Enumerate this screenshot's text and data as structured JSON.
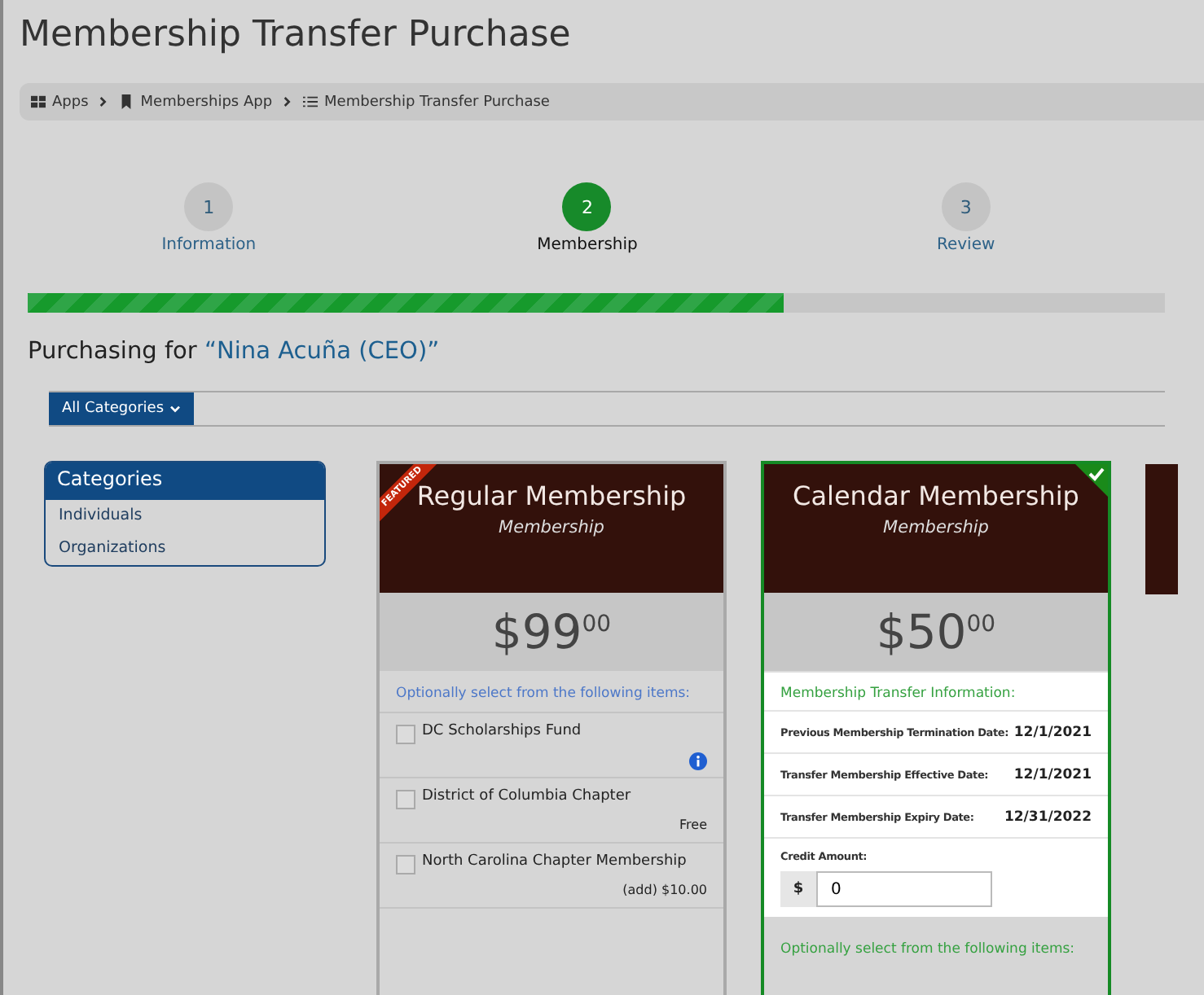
{
  "title": "Membership Transfer Purchase",
  "breadcrumbs": [
    {
      "label": "Apps"
    },
    {
      "label": "Memberships App"
    },
    {
      "label": "Membership Transfer Purchase"
    }
  ],
  "steps": [
    {
      "number": "1",
      "label": "Information",
      "selected": false
    },
    {
      "number": "2",
      "label": "Membership",
      "selected": true
    },
    {
      "number": "3",
      "label": "Review",
      "selected": false
    }
  ],
  "progress": {
    "level": 0.665
  },
  "purchasing": {
    "prefix": "Purchasing for ",
    "name": "“Nina Acuña (CEO)”"
  },
  "filter_button": "All Categories",
  "categories": {
    "title": "Categories",
    "items": [
      "Individuals",
      "Organizations"
    ]
  },
  "cards": [
    {
      "title": "Regular Membership",
      "subtitle": "Membership",
      "badge": "FEATURED",
      "selected": false,
      "price": "$99",
      "cents": "00",
      "sections": [
        {
          "kind": "options",
          "heading": "Optionally select from the following items:",
          "items": [
            {
              "label": "DC Scholarships Fund",
              "checked": false,
              "kind": "info"
            },
            {
              "label": "District of Columbia Chapter",
              "checked": false,
              "kind": "priced",
              "note": "Free"
            },
            {
              "label": "North Carolina Chapter Membership",
              "checked": false,
              "kind": "priced",
              "note": "(add) $10.00"
            }
          ]
        }
      ]
    },
    {
      "title": "Calendar Membership",
      "subtitle": "Membership",
      "selected": true,
      "price": "$50",
      "cents": "00",
      "sections": [
        {
          "kind": "transfer",
          "heading": "Membership Transfer Information:",
          "rows": [
            {
              "label": "Previous Membership Termination Date:",
              "value": "12/1/2021"
            },
            {
              "label": "Transfer Membership Effective Date:",
              "value": "12/1/2021"
            },
            {
              "label": "Transfer Membership Expiry Date:",
              "value": "12/31/2022"
            }
          ],
          "credit_label": "Credit Amount:",
          "currency": "$",
          "credit_value": "0"
        },
        {
          "kind": "options",
          "heading": "Optionally select from the following items:"
        }
      ]
    }
  ]
}
